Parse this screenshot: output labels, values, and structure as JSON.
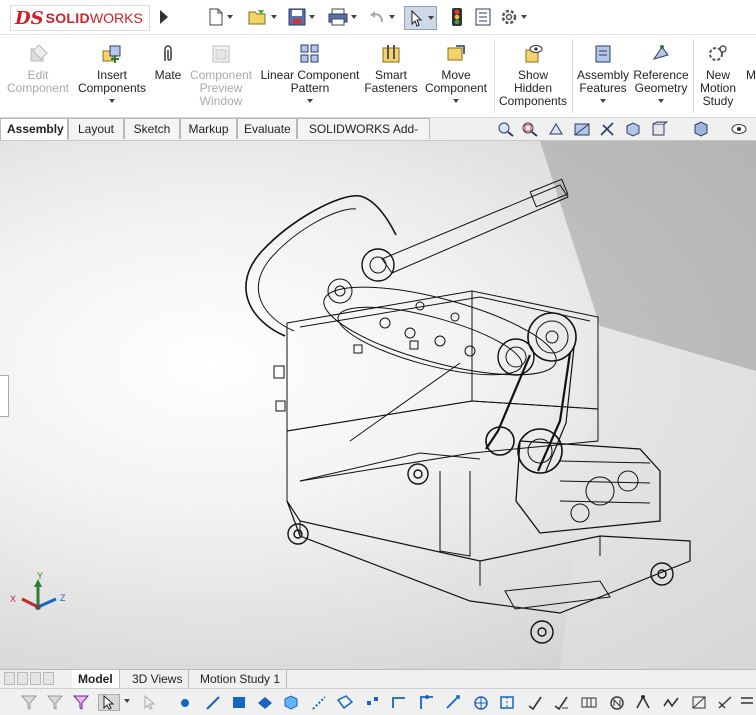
{
  "app": {
    "logo_prefix": "DS",
    "logo_solid": "SOLID",
    "logo_works": "WORKS"
  },
  "ribbon": {
    "buttons": [
      {
        "label": "Edit Component",
        "lines": [
          "Edit",
          "Component"
        ],
        "enabled": false,
        "icon": "edit-component-icon"
      },
      {
        "label": "Insert Components",
        "lines": [
          "Insert",
          "Components"
        ],
        "enabled": true,
        "icon": "insert-components-icon"
      },
      {
        "label": "Mate",
        "lines": [
          "Mate"
        ],
        "enabled": true,
        "icon": "paperclip-mate-icon"
      },
      {
        "label": "Component Preview Window",
        "lines": [
          "Component",
          "Preview",
          "Window"
        ],
        "enabled": false,
        "icon": "preview-window-icon"
      },
      {
        "label": "Linear Component Pattern",
        "lines": [
          "Linear Component",
          "Pattern"
        ],
        "enabled": true,
        "icon": "linear-pattern-icon"
      },
      {
        "label": "Smart Fasteners",
        "lines": [
          "Smart",
          "Fasteners"
        ],
        "enabled": true,
        "icon": "smart-fasteners-icon"
      },
      {
        "label": "Move Component",
        "lines": [
          "Move",
          "Component"
        ],
        "enabled": true,
        "icon": "move-component-icon"
      },
      {
        "label": "Show Hidden Components",
        "lines": [
          "Show",
          "Hidden",
          "Components"
        ],
        "enabled": true,
        "icon": "show-hidden-icon"
      },
      {
        "label": "Assembly Features",
        "lines": [
          "Assembly",
          "Features"
        ],
        "enabled": true,
        "icon": "assembly-features-icon"
      },
      {
        "label": "Reference Geometry",
        "lines": [
          "Reference",
          "Geometry"
        ],
        "enabled": true,
        "icon": "reference-geometry-icon"
      },
      {
        "label": "New Motion Study",
        "lines": [
          "New",
          "Motion",
          "Study"
        ],
        "enabled": true,
        "icon": "motion-study-icon"
      },
      {
        "label": "M",
        "lines": [
          "M"
        ],
        "enabled": true,
        "icon": ""
      }
    ]
  },
  "command_tabs": [
    "Assembly",
    "Layout",
    "Sketch",
    "Markup",
    "Evaluate",
    "SOLIDWORKS Add-Ins"
  ],
  "command_tab_active": "Assembly",
  "triad": {
    "x": "X",
    "y": "Y",
    "z": "Z"
  },
  "bottom_tabs": [
    "Model",
    "3D Views",
    "Motion Study 1"
  ],
  "bottom_tab_active": "Model",
  "colors": {
    "brand_red": "#d32027",
    "ribbon_bg": "#ffffff",
    "viewport_light": "#ffffff",
    "viewport_dark": "#c9c9c9"
  }
}
